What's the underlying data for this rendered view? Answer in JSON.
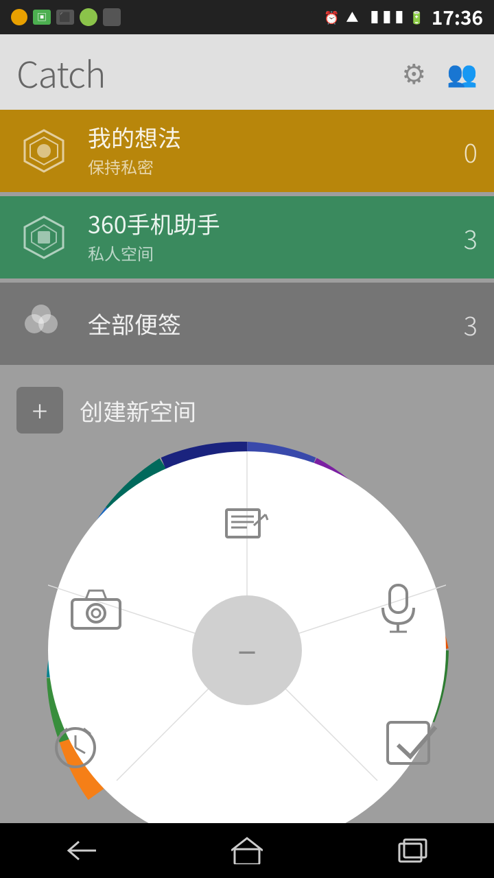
{
  "statusBar": {
    "time": "17:36"
  },
  "header": {
    "title": "Catch",
    "settingsLabel": "settings",
    "usersLabel": "users"
  },
  "listItems": [
    {
      "id": "my-ideas",
      "title": "我的想法",
      "subtitle": "保持私密",
      "count": "0",
      "bgColor": "#b8860b"
    },
    {
      "id": "360-assistant",
      "title": "360手机助手",
      "subtitle": "私人空间",
      "count": "3",
      "bgColor": "#3a8a5e"
    },
    {
      "id": "all-notes",
      "title": "全部便签",
      "subtitle": "",
      "count": "3",
      "bgColor": "#757575"
    }
  ],
  "createItem": {
    "label": "创建新空间"
  },
  "radialMenu": {
    "centerIcon": "−",
    "items": [
      {
        "id": "note",
        "label": "笔记",
        "icon": "note"
      },
      {
        "id": "voice",
        "label": "语音",
        "icon": "mic"
      },
      {
        "id": "checklist",
        "label": "清单",
        "icon": "check"
      },
      {
        "id": "alarm",
        "label": "闹钟",
        "icon": "alarm"
      },
      {
        "id": "camera",
        "label": "相机",
        "icon": "camera"
      }
    ]
  },
  "bottomNav": {
    "backLabel": "back",
    "homeLabel": "home",
    "recentLabel": "recent"
  }
}
